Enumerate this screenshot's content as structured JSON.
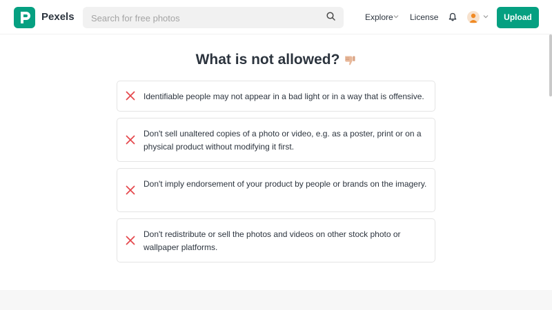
{
  "header": {
    "brand": "Pexels",
    "logo_letter": "P",
    "search_placeholder": "Search for free photos",
    "nav": {
      "explore": "Explore",
      "license": "License"
    },
    "upload_label": "Upload"
  },
  "main": {
    "heading": "What is not allowed?",
    "rules": [
      {
        "text": "Identifiable people may not appear in a bad light or in a way that is offensive."
      },
      {
        "text": "Don't sell unaltered copies of a photo or video, e.g. as a poster, print or on a physical product without modifying it first."
      },
      {
        "text": "Don't imply endorsement of your product by people or brands on the imagery."
      },
      {
        "text": "Don't redistribute or sell the photos and videos on other stock photo or wallpaper platforms."
      }
    ]
  },
  "icons": {
    "logo": "pexels-logo-icon",
    "search": "search-icon",
    "chevron": "chevron-down-icon",
    "notifications": "bell-icon",
    "avatar": "user-avatar-icon",
    "thumbs_down": "thumbs-down-icon",
    "rule_marker": "x-icon"
  },
  "colors": {
    "brand": "#05a081",
    "text": "#2c343e",
    "x_mark": "#e5484d",
    "search_bg": "#f1f1f1",
    "card_border": "#e4e4e4"
  }
}
